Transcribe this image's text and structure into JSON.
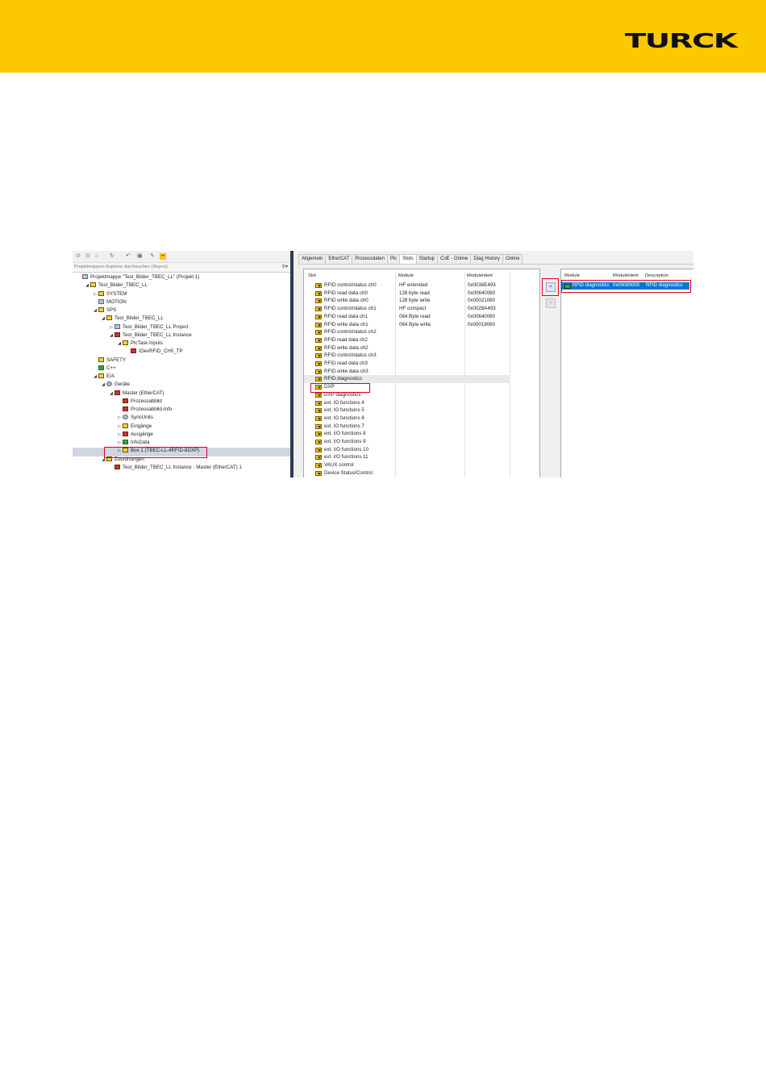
{
  "header": {
    "logo_text": "TURCK",
    "brand_color": "#fcc800"
  },
  "explorer": {
    "toolbar_icons": [
      "back-icon",
      "forward-icon",
      "home-icon",
      "sync-icon",
      "undo-icon",
      "collapse-icon",
      "properties-icon",
      "wrench-icon",
      "pin-icon"
    ],
    "search_placeholder": "Projektmappen-Explorer durchsuchen (Strg+ü)",
    "tree": [
      {
        "label": "Projektmappe \"Test_Bilder_TBEC_LL\" (Projekt 1)",
        "level": 0,
        "icon": "sol",
        "arrow": ""
      },
      {
        "label": "Test_Bilder_TBEC_LL",
        "level": 1,
        "icon": "box",
        "arrow": "◢"
      },
      {
        "label": "SYSTEM",
        "level": 2,
        "icon": "box",
        "arrow": "▷"
      },
      {
        "label": "MOTION",
        "level": 2,
        "icon": "sol",
        "arrow": ""
      },
      {
        "label": "SPS",
        "level": 2,
        "icon": "box",
        "arrow": "◢"
      },
      {
        "label": "Test_Bilder_TBEC_LL",
        "level": 3,
        "icon": "box",
        "arrow": "◢"
      },
      {
        "label": "Test_Bilder_TBEC_LL Project",
        "level": 4,
        "icon": "sol",
        "arrow": "▷"
      },
      {
        "label": "Test_Bilder_TBEC_LL Instance",
        "level": 4,
        "icon": "red",
        "arrow": "◢"
      },
      {
        "label": "PlcTask Inputs",
        "level": 5,
        "icon": "box",
        "arrow": "◢"
      },
      {
        "label": "IOexRFID_CH0_TP",
        "level": 6,
        "icon": "red",
        "arrow": ""
      },
      {
        "label": "SAFETY",
        "level": 2,
        "icon": "box",
        "arrow": ""
      },
      {
        "label": "C++",
        "level": 2,
        "icon": "grn",
        "arrow": ""
      },
      {
        "label": "E/A",
        "level": 2,
        "icon": "box",
        "arrow": "◢"
      },
      {
        "label": "Geräte",
        "level": 3,
        "icon": "gear",
        "arrow": "◢"
      },
      {
        "label": "Master (EtherCAT)",
        "level": 4,
        "icon": "red",
        "arrow": "◢"
      },
      {
        "label": "Prozessabbild",
        "level": 5,
        "icon": "red",
        "arrow": ""
      },
      {
        "label": "Prozessabbild-Info",
        "level": 5,
        "icon": "red",
        "arrow": ""
      },
      {
        "label": "SyncUnits",
        "level": 5,
        "icon": "gear",
        "arrow": "▷"
      },
      {
        "label": "Eingänge",
        "level": 5,
        "icon": "box",
        "arrow": "▷"
      },
      {
        "label": "Ausgänge",
        "level": 5,
        "icon": "red",
        "arrow": "▷"
      },
      {
        "label": "InfoData",
        "level": 5,
        "icon": "grn",
        "arrow": "▷"
      },
      {
        "label": "Box 1 (TBEC-LL-4RFID-8DXP)",
        "level": 5,
        "icon": "box",
        "arrow": "▷",
        "selected": true
      },
      {
        "label": "Zuordnungen",
        "level": 3,
        "icon": "box",
        "arrow": "◢"
      },
      {
        "label": "Test_Bilder_TBEC_LL Instance - Master (EtherCAT) 1",
        "level": 4,
        "icon": "red",
        "arrow": ""
      }
    ]
  },
  "tabs": [
    "Allgemein",
    "EtherCAT",
    "Prozessdaten",
    "Plc",
    "Slots",
    "Startup",
    "CoE - Online",
    "Diag History",
    "Online"
  ],
  "active_tab": "Slots",
  "slots": {
    "headers": {
      "slot": "Slot",
      "module": "Module",
      "ident": "ModuleIdent"
    },
    "rows": [
      {
        "slot": "RFID control/status ch0",
        "module": "HF extended",
        "ident": "0x0038E493"
      },
      {
        "slot": "RFID read data ch0",
        "module": "128 byte read",
        "ident": "0x00640080"
      },
      {
        "slot": "RFID write data ch0",
        "module": "128 byte write",
        "ident": "0x00021080"
      },
      {
        "slot": "RFID control/status ch1",
        "module": "HF compact",
        "ident": "0x0028A493"
      },
      {
        "slot": "RFID read data ch1",
        "module": "064 Byte read",
        "ident": "0x00640080"
      },
      {
        "slot": "RFID write data ch1",
        "module": "064 Byte write",
        "ident": "0x00019080"
      },
      {
        "slot": "RFID control/status ch2",
        "module": "",
        "ident": ""
      },
      {
        "slot": "RFID read data ch2",
        "module": "",
        "ident": ""
      },
      {
        "slot": "RFID write data ch2",
        "module": "",
        "ident": ""
      },
      {
        "slot": "RFID control/status ch3",
        "module": "",
        "ident": ""
      },
      {
        "slot": "RFID read data ch3",
        "module": "",
        "ident": ""
      },
      {
        "slot": "RFID write data ch3",
        "module": "",
        "ident": ""
      },
      {
        "slot": "RFID diagnostics",
        "module": "",
        "ident": "",
        "highlight": true
      },
      {
        "slot": "DXP",
        "module": "",
        "ident": ""
      },
      {
        "slot": "DXP diagnostics",
        "module": "",
        "ident": ""
      },
      {
        "slot": "ext. IO functions 4",
        "module": "",
        "ident": ""
      },
      {
        "slot": "ext. IO functions 5",
        "module": "",
        "ident": ""
      },
      {
        "slot": "ext. IO functions 6",
        "module": "",
        "ident": ""
      },
      {
        "slot": "ext. IO functions 7",
        "module": "",
        "ident": ""
      },
      {
        "slot": "ext. I/O functions 8",
        "module": "",
        "ident": ""
      },
      {
        "slot": "ext. I/O functions 9",
        "module": "",
        "ident": ""
      },
      {
        "slot": "ext. I/O functions 10",
        "module": "",
        "ident": ""
      },
      {
        "slot": "ext. I/O functions 11",
        "module": "",
        "ident": ""
      },
      {
        "slot": "VAUX control",
        "module": "",
        "ident": ""
      },
      {
        "slot": "Device Status/Control",
        "module": "",
        "ident": ""
      }
    ]
  },
  "buttons": {
    "insert": "<",
    "remove": ">"
  },
  "modules": {
    "headers": {
      "module": "Module",
      "ident": "ModuleIdent",
      "desc": "Description"
    },
    "selected": {
      "module": "RFID diagnostics",
      "ident": "0x00080000",
      "desc": "RFID diagnostics"
    }
  }
}
